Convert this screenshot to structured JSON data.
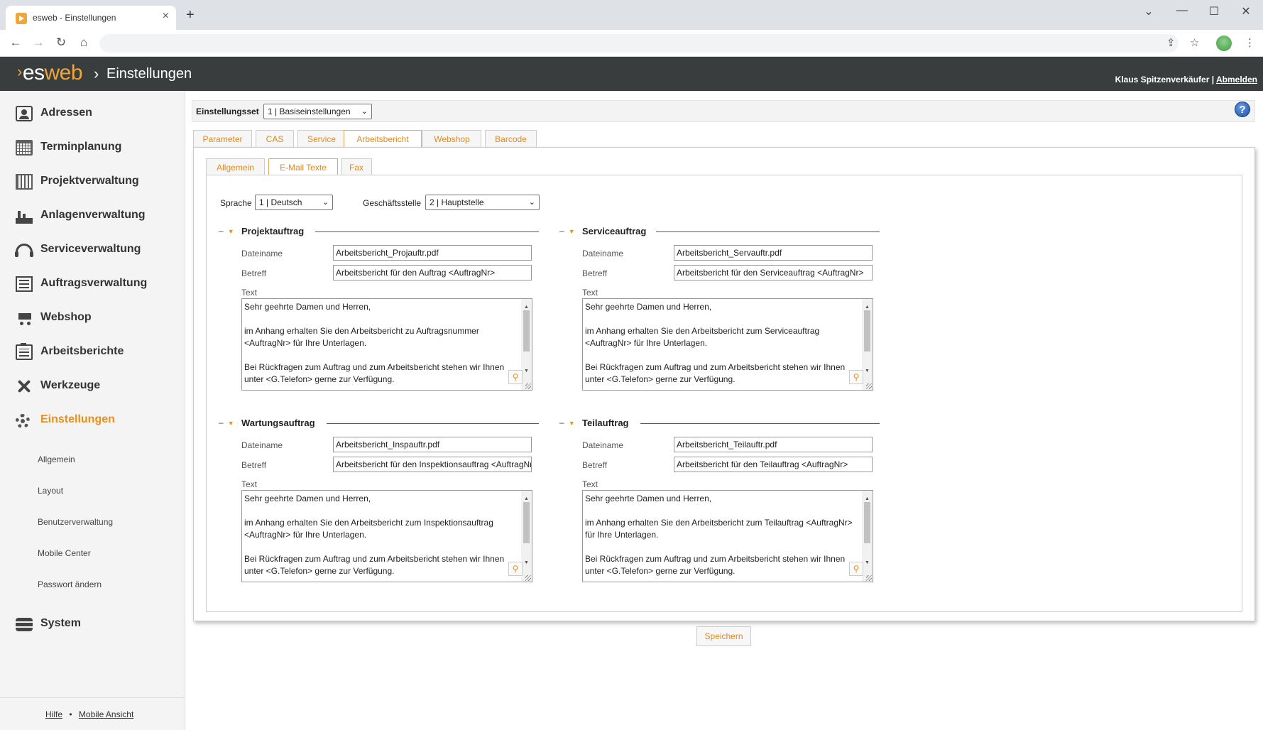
{
  "browser": {
    "tab_title": "esweb - Einstellungen",
    "new_tab": "+",
    "win_minimize": "⌄",
    "win_min": "—",
    "win_max": "☐",
    "win_close": "✕"
  },
  "app": {
    "logo_es": "es",
    "logo_web": "web",
    "breadcrumb_sep": "›",
    "title": "Einstellungen",
    "user_name": "Klaus Spitzenverkäufer",
    "user_sep": " | ",
    "logout": "Abmelden"
  },
  "sidebar": {
    "items": [
      {
        "label": "Adressen",
        "icon": "address-book-icon"
      },
      {
        "label": "Terminplanung",
        "icon": "calendar-icon"
      },
      {
        "label": "Projektverwaltung",
        "icon": "project-icon"
      },
      {
        "label": "Anlagenverwaltung",
        "icon": "factory-icon"
      },
      {
        "label": "Serviceverwaltung",
        "icon": "headset-icon"
      },
      {
        "label": "Auftragsverwaltung",
        "icon": "order-list-icon"
      },
      {
        "label": "Webshop",
        "icon": "cart-icon"
      },
      {
        "label": "Arbeitsberichte",
        "icon": "clipboard-icon"
      },
      {
        "label": "Werkzeuge",
        "icon": "tools-icon"
      },
      {
        "label": "Einstellungen",
        "icon": "gears-icon"
      },
      {
        "label": "System",
        "icon": "database-icon"
      }
    ],
    "subitems": [
      "Allgemein",
      "Layout",
      "Benutzerverwaltung",
      "Mobile Center",
      "Passwort ändern"
    ],
    "footer": {
      "help": "Hilfe",
      "dot": "•",
      "mobile": "Mobile Ansicht"
    }
  },
  "settings": {
    "set_label": "Einstellungsset",
    "set_value": "1 | Basiseinstellungen",
    "help": "?"
  },
  "tabs": [
    "Parameter",
    "CAS",
    "Service",
    "Arbeitsbericht",
    "Webshop",
    "Barcode"
  ],
  "subtabs": [
    "Allgemein",
    "E-Mail Texte",
    "Fax"
  ],
  "filters": {
    "lang_label": "Sprache",
    "lang_value": "1 | Deutsch",
    "branch_label": "Geschäftsstelle",
    "branch_value": "2 | Hauptstelle"
  },
  "labels": {
    "filename": "Dateiname",
    "subject": "Betreff",
    "text": "Text",
    "collapse": "–"
  },
  "sections": [
    {
      "title": "Projektauftrag",
      "filename": "Arbeitsbericht_Projauftr.pdf",
      "subject": "Arbeitsbericht für den Auftrag <AuftragNr>",
      "text": [
        "Sehr geehrte Damen und Herren,",
        "im Anhang erhalten Sie den Arbeitsbericht zu Auftragsnummer <AuftragNr> für Ihre Unterlagen.",
        "Bei Rückfragen zum Auftrag und zum Arbeitsbericht stehen wir Ihnen unter <G.Telefon> gerne zur Verfügung."
      ]
    },
    {
      "title": "Serviceauftrag",
      "filename": "Arbeitsbericht_Servauftr.pdf",
      "subject": "Arbeitsbericht für den Serviceauftrag <AuftragNr>",
      "text": [
        "Sehr geehrte Damen und Herren,",
        "im Anhang erhalten Sie den Arbeitsbericht zum Serviceauftrag <AuftragNr> für Ihre Unterlagen.",
        "Bei Rückfragen zum Auftrag und zum Arbeitsbericht stehen wir Ihnen unter <G.Telefon> gerne zur Verfügung."
      ]
    },
    {
      "title": "Wartungsauftrag",
      "filename": "Arbeitsbericht_Inspauftr.pdf",
      "subject": "Arbeitsbericht für den Inspektionsauftrag <AuftragNr>",
      "text": [
        "Sehr geehrte Damen und Herren,",
        "im Anhang erhalten Sie den Arbeitsbericht zum Inspektionsauftrag <AuftragNr> für Ihre Unterlagen.",
        "Bei Rückfragen zum Auftrag und zum Arbeitsbericht stehen wir Ihnen unter <G.Telefon> gerne zur Verfügung."
      ]
    },
    {
      "title": "Teilauftrag",
      "filename": "Arbeitsbericht_Teilauftr.pdf",
      "subject": "Arbeitsbericht für den Teilauftrag <AuftragNr>",
      "text": [
        "Sehr geehrte Damen und Herren,",
        "im Anhang erhalten Sie den Arbeitsbericht zum Teilauftrag <AuftragNr> für Ihre Unterlagen.",
        "Bei Rückfragen zum Auftrag und zum Arbeitsbericht stehen wir Ihnen unter <G.Telefon> gerne zur Verfügung."
      ]
    }
  ],
  "save_button": "Speichern",
  "colors": {
    "accent": "#e8901e",
    "header_bg": "#3a3d3d",
    "sidebar_bg": "#f4f4f4"
  }
}
